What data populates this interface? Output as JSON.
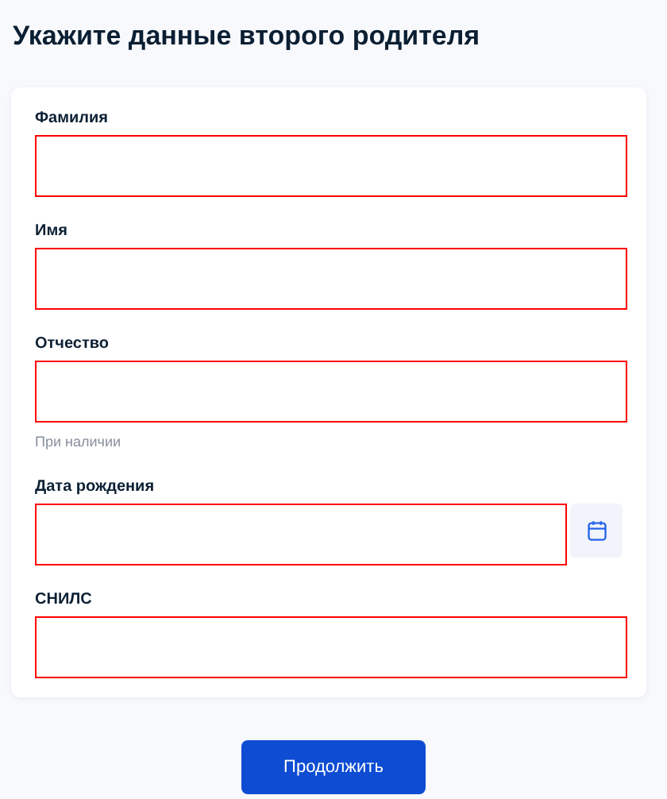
{
  "title": "Укажите данные второго родителя",
  "fields": [
    {
      "kind": "text",
      "label": "Фамилия",
      "invalid": true
    },
    {
      "kind": "text",
      "label": "Имя",
      "invalid": true
    },
    {
      "kind": "text",
      "label": "Отчество",
      "invalid": true,
      "hint": "При наличии"
    },
    {
      "kind": "date",
      "label": "Дата рождения",
      "invalid": true
    },
    {
      "kind": "text",
      "label": "СНИЛС",
      "invalid": true
    }
  ],
  "submit": "Продолжить"
}
